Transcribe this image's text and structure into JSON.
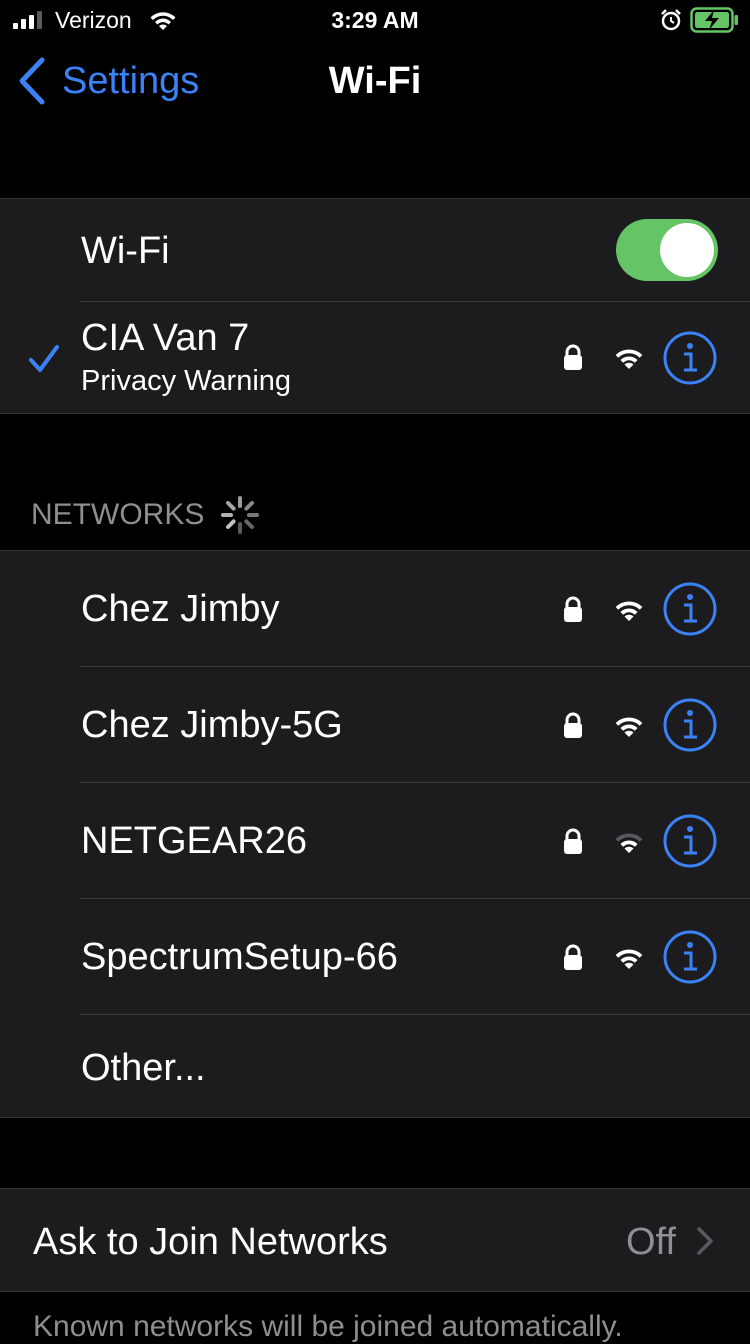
{
  "status_bar": {
    "carrier": "Verizon",
    "time": "3:29 AM",
    "icons": [
      "signal-icon",
      "wifi-icon",
      "alarm-icon",
      "battery-charging-icon"
    ]
  },
  "nav": {
    "back_label": "Settings",
    "title": "Wi-Fi"
  },
  "wifi_toggle": {
    "label": "Wi-Fi",
    "on": true
  },
  "connected_network": {
    "name": "CIA Van 7",
    "subtitle": "Privacy Warning",
    "secured": true
  },
  "networks_header": "NETWORKS",
  "networks": [
    {
      "name": "Chez Jimby",
      "secured": true,
      "signal": "full"
    },
    {
      "name": "Chez Jimby-5G",
      "secured": true,
      "signal": "full"
    },
    {
      "name": "NETGEAR26",
      "secured": true,
      "signal": "weak"
    },
    {
      "name": "SpectrumSetup-66",
      "secured": true,
      "signal": "full"
    }
  ],
  "other_label": "Other...",
  "ask_to_join": {
    "label": "Ask to Join Networks",
    "value": "Off"
  },
  "footer": "Known networks will be joined automatically.",
  "colors": {
    "accent": "#3b82f6",
    "toggle_on": "#65c466",
    "background": "#000000",
    "group_bg": "#1c1c1e",
    "secondary_text": "#8e8e93"
  }
}
